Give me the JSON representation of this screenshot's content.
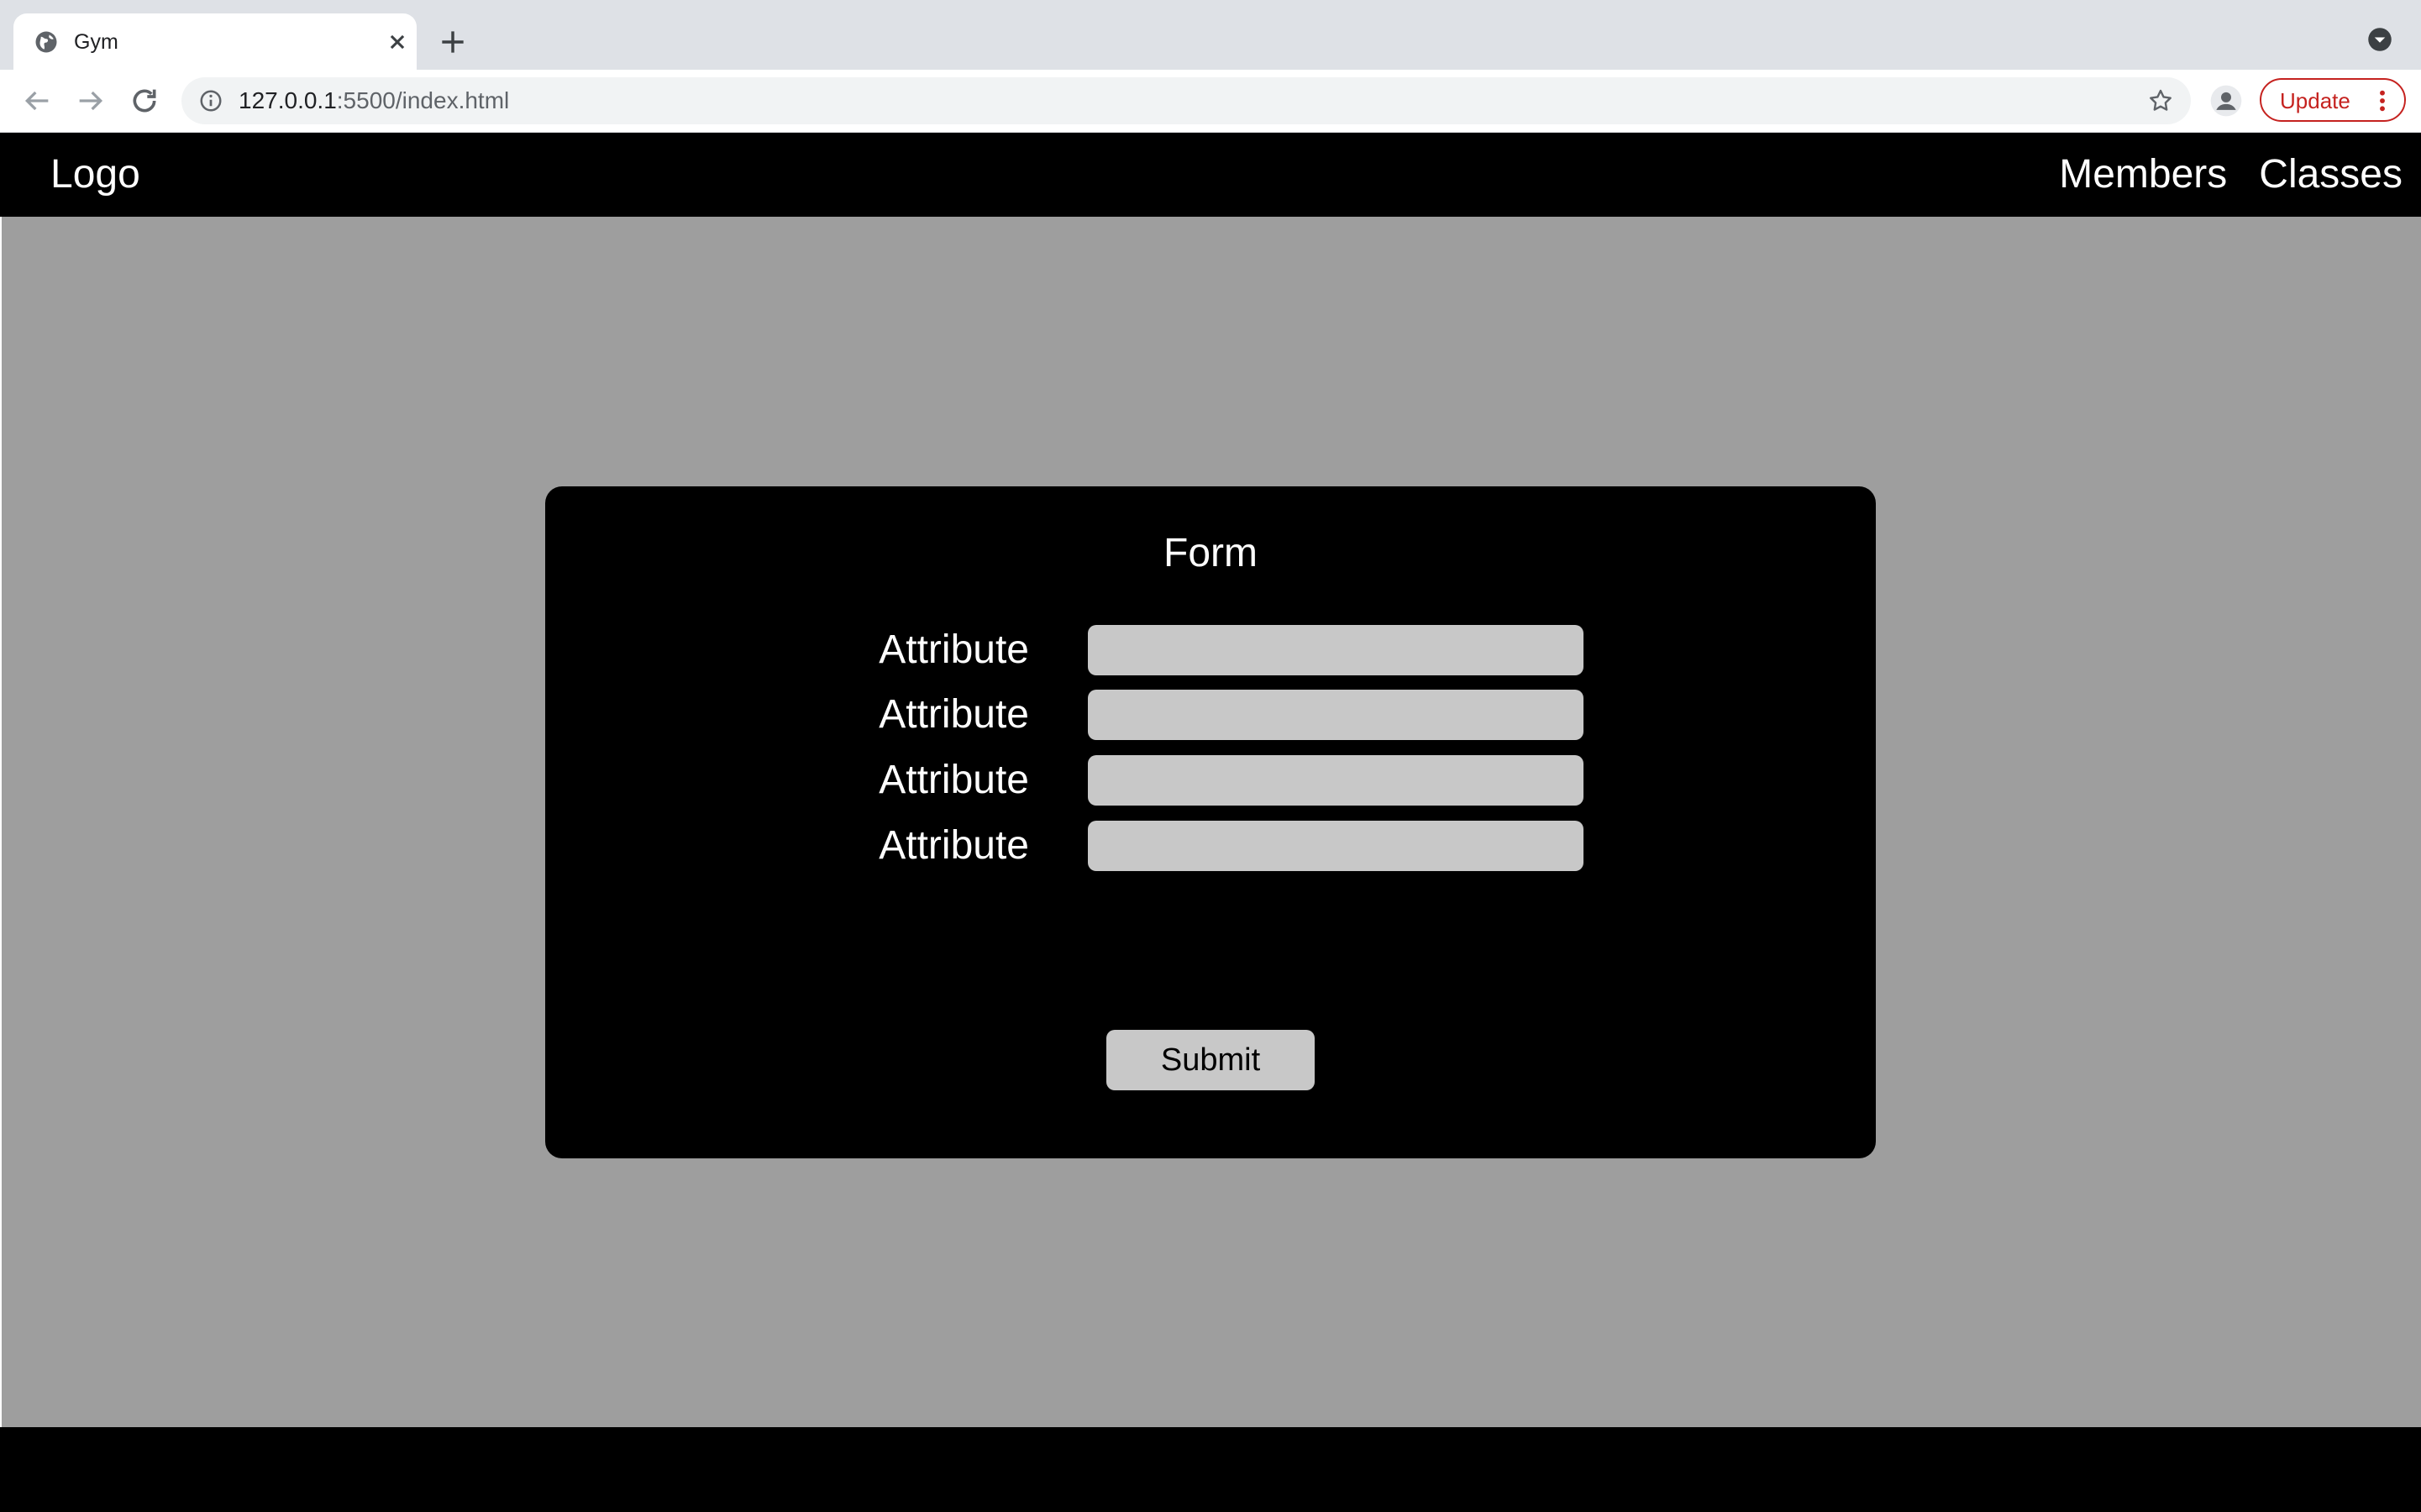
{
  "browser": {
    "tab_title": "Gym",
    "url_host": "127.0.0.1",
    "url_rest": ":5500/index.html",
    "update_label": "Update"
  },
  "navbar": {
    "logo": "Logo",
    "links": [
      {
        "label": "Members"
      },
      {
        "label": "Classes"
      }
    ]
  },
  "form": {
    "title": "Form",
    "fields": [
      {
        "label": "Attribute",
        "value": ""
      },
      {
        "label": "Attribute",
        "value": ""
      },
      {
        "label": "Attribute",
        "value": ""
      },
      {
        "label": "Attribute",
        "value": ""
      }
    ],
    "submit_label": "Submit"
  },
  "colors": {
    "page_background": "#9e9e9e",
    "card_background": "#000000",
    "input_background": "#c8c8c8",
    "update_accent": "#c5221f"
  }
}
